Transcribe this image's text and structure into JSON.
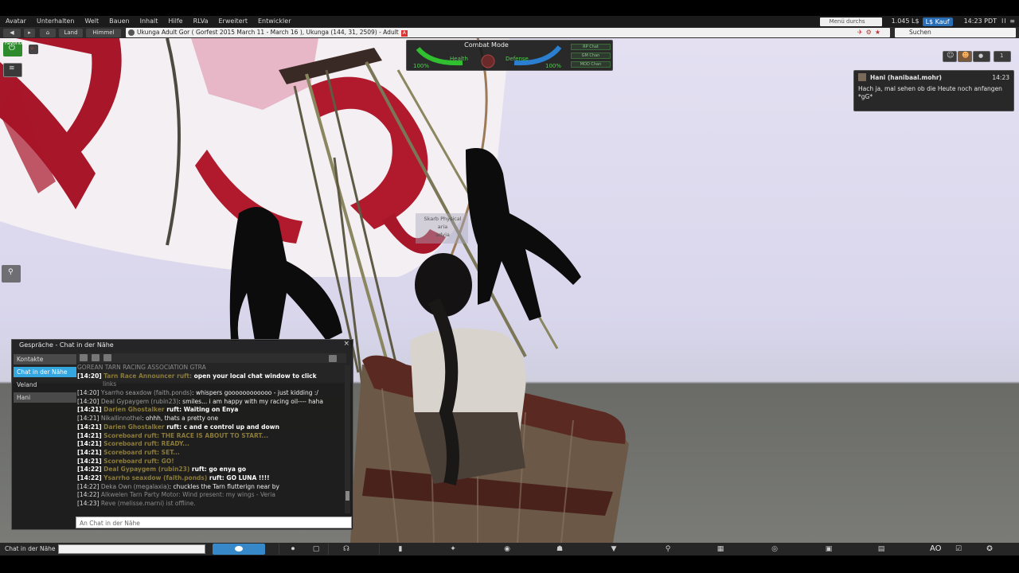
{
  "menubar": {
    "items": [
      "Avatar",
      "Unterhalten",
      "Welt",
      "Bauen",
      "Inhalt",
      "Hilfe",
      "RLVa",
      "Erweitert",
      "Entwickler"
    ],
    "search_placeholder": "Menü durchs",
    "balance": "1.045 L$",
    "buy_label": "L$ Kauf",
    "clock": "14:23 PDT",
    "media_icons": "II ≡"
  },
  "navbar": {
    "land_label": "Land",
    "sky_label": "Himmel",
    "location": "Ukunga Adult Gor ( Gorfest 2015 March 11 - March 16 ), Ukunga (144, 31, 2509) - Adult",
    "adult_flag": "A",
    "search_placeholder": "Suchen"
  },
  "sidebar": {
    "favorites_label": "Favoriten"
  },
  "hud": {
    "title": "Combat Mode",
    "health_label": "Health",
    "defense_label": "Defense",
    "health_pct": "100%",
    "defense_pct": "100%",
    "channels": [
      "RP Chat",
      "GM Chan",
      "MOD Chan"
    ],
    "floating_text": [
      "Skarb Physical",
      "aria",
      "adyia"
    ]
  },
  "toast": {
    "name": "Hani (hanibaal.mohr)",
    "time": "14:23",
    "message": "Hach ja, mal sehen ob die Heute noch anfangen *gG*"
  },
  "chat": {
    "title": "Gespräche - Chat in der Nähe",
    "tabs": [
      "Kontakte",
      "Chat in der Nähe",
      "Veland",
      "Hani"
    ],
    "input_placeholder": "An Chat in der Nähe",
    "lines": [
      {
        "time": "",
        "name": "GOREAN TARN RACING ASSOCIATION GTRA",
        "text": "",
        "style": "dimhead"
      },
      {
        "time": "[14:20]",
        "name": "Tarn Race Announcer ruft:",
        "text": " open your local chat window to click",
        "style": "boldname"
      },
      {
        "time": "",
        "name": "",
        "text": "links",
        "style": "cont"
      },
      {
        "time": "[14:20]",
        "name": "Ysarrho seaxdow (faith.ponds)",
        "text": ": whispers goooooooooooo - just kidding :/",
        "style": "normal"
      },
      {
        "time": "[14:20]",
        "name": "Deal Gypaygem (rubin23)",
        "text": ": smiles... i am happy with my racing oil---- haha",
        "style": "normal"
      },
      {
        "time": "[14:21]",
        "name": "Darien Ghostalker",
        "text": " ruft: Waiting on Enya",
        "style": "bold"
      },
      {
        "time": "[14:21]",
        "name": "Nikallinnothel",
        "text": ": ohhh, thats a pretty one",
        "style": "normal"
      },
      {
        "time": "[14:21]",
        "name": "Darien Ghostalker",
        "text": " ruft: c and e control up and down",
        "style": "bold"
      },
      {
        "time": "[14:21]",
        "name": "Scoreboard ruft: THE RACE IS ABOUT TO START...",
        "text": "",
        "style": "bolddim"
      },
      {
        "time": "[14:21]",
        "name": "Scoreboard ruft: READY...",
        "text": "",
        "style": "bolddim"
      },
      {
        "time": "[14:21]",
        "name": "Scoreboard ruft: SET...",
        "text": "",
        "style": "bolddim"
      },
      {
        "time": "[14:21]",
        "name": "Scoreboard ruft: GO!",
        "text": "",
        "style": "bolddim"
      },
      {
        "time": "[14:22]",
        "name": "Deal Gypaygem (rubin23)",
        "text": " ruft: go enya go",
        "style": "bold"
      },
      {
        "time": "[14:22]",
        "name": "Ysarrho seaxdow (faith.ponds)",
        "text": " ruft: GO LUNA !!!!",
        "style": "bold"
      },
      {
        "time": "[14:22]",
        "name": "Deka Own (megalaxia)",
        "text": ": chuckles the Tarn flutterign near by",
        "style": "normal"
      },
      {
        "time": "[14:22]",
        "name": "Alkwelen Tarn Party Motor: Wind present: my wings - Veria",
        "text": "",
        "style": "dimline"
      },
      {
        "time": "[14:23]",
        "name": "Reve (melisse.marni) ist offline.",
        "text": "",
        "style": "dimline"
      }
    ]
  },
  "bottombar": {
    "chat_label": "Chat in der Nähe",
    "ao_label": "AO"
  },
  "colors": {
    "accent": "#34a6e0",
    "sky": "#dcd9ee",
    "ground": "#717270",
    "balloon_red": "#a8162a",
    "hud_green": "#4fd04f"
  }
}
